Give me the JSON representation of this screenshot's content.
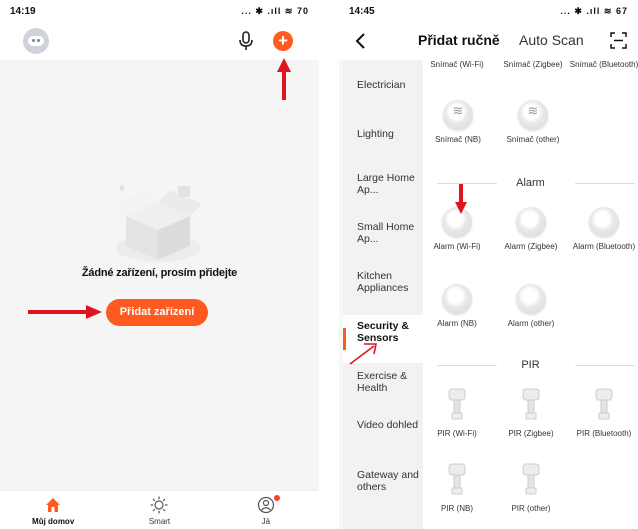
{
  "left": {
    "status": {
      "time": "14:19",
      "icons": "... ✱ .ıll ≋ 70"
    },
    "empty_text": "Žádné zařízení, prosím přidejte",
    "add_button": "Přidat zařízení",
    "nav": [
      {
        "label": "Můj domov",
        "icon": "home-icon"
      },
      {
        "label": "Smart",
        "icon": "sun-icon"
      },
      {
        "label": "Já",
        "icon": "profile-icon"
      }
    ]
  },
  "right": {
    "status": {
      "time": "14:45",
      "icons": "... ✱ .ıll ≋ 67"
    },
    "tabs": {
      "manual": "Přidat ručně",
      "auto": "Auto Scan"
    },
    "sidebar": [
      {
        "label": "Electrician"
      },
      {
        "label": "Lighting"
      },
      {
        "label": "Large Home Ap..."
      },
      {
        "label": "Small Home Ap..."
      },
      {
        "label": "Kitchen Appliances"
      },
      {
        "label": "Security & Sensors",
        "active": true
      },
      {
        "label": "Exercise & Health"
      },
      {
        "label": "Video dohled"
      },
      {
        "label": "Gateway and others"
      }
    ],
    "top_partial": [
      {
        "label": "Snímač (Wi-Fi)"
      },
      {
        "label": "Snímač (Zigbee)"
      },
      {
        "label": "Snímač (Bluetooth)"
      }
    ],
    "sensors_row": [
      {
        "label": "Snímač (NB)"
      },
      {
        "label": "Snímač (other)"
      }
    ],
    "alarm": {
      "title": "Alarm",
      "devices": [
        {
          "label": "Alarm (Wi-Fi)"
        },
        {
          "label": "Alarm (Zigbee)"
        },
        {
          "label": "Alarm (Bluetooth)"
        },
        {
          "label": "Alarm (NB)"
        },
        {
          "label": "Alarm (other)"
        }
      ]
    },
    "pir": {
      "title": "PIR",
      "devices": [
        {
          "label": "PIR (Wi-Fi)"
        },
        {
          "label": "PIR (Zigbee)"
        },
        {
          "label": "PIR (Bluetooth)"
        },
        {
          "label": "PIR (NB)"
        },
        {
          "label": "PIR (other)"
        }
      ]
    }
  },
  "colors": {
    "accent": "#ff5a1f",
    "annotation": "#e0141e"
  }
}
